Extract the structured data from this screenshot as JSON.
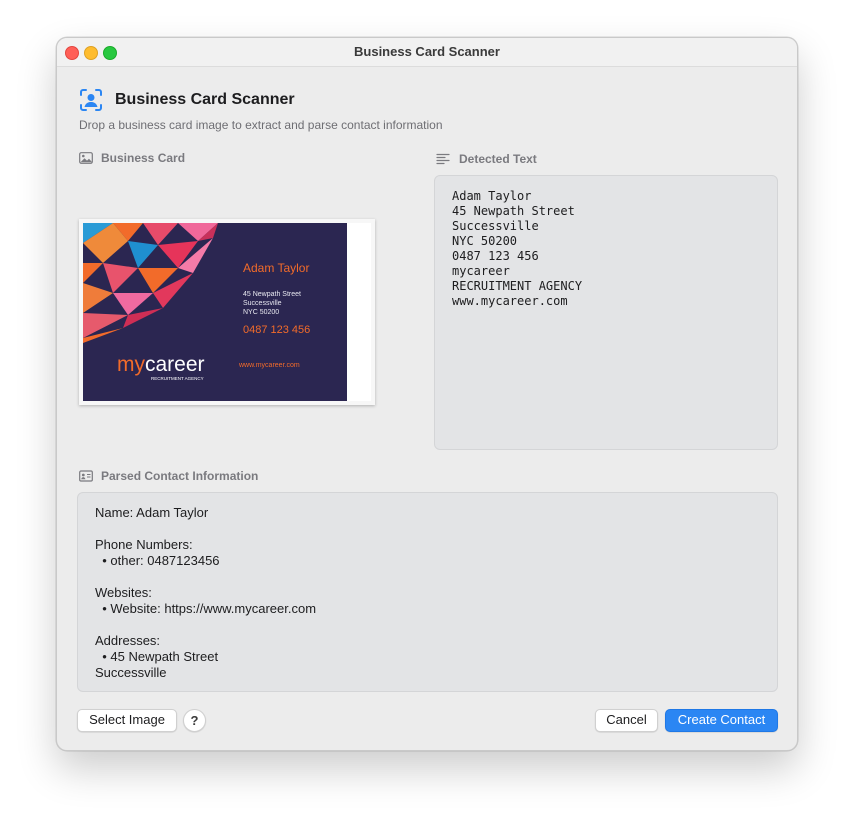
{
  "window": {
    "title": "Business Card Scanner"
  },
  "header": {
    "icon": "person-viewfinder-icon",
    "title": "Business Card Scanner",
    "subtitle": "Drop a business card image to extract and parse contact information"
  },
  "business_card_section": {
    "label": "Business Card",
    "icon": "photo-icon",
    "card": {
      "name": "Adam Taylor",
      "address_lines": [
        "45 Newpath Street",
        "Successville",
        "NYC 50200"
      ],
      "phone": "0487 123 456",
      "brand_my": "my",
      "brand_career": "career",
      "brand_tagline": "RECRUITMENT AGENCY",
      "website": "www.mycareer.com",
      "colors": {
        "background": "#2b2651",
        "accent": "#f26b2a"
      }
    }
  },
  "detected_section": {
    "label": "Detected Text",
    "icon": "text-align-left-icon",
    "lines": [
      "Adam Taylor",
      "45 Newpath Street",
      "Successville",
      "NYC 50200",
      "0487 123 456",
      "mycareer",
      "RECRUITMENT AGENCY",
      "www.mycareer.com"
    ]
  },
  "parsed_section": {
    "label": "Parsed Contact Information",
    "icon": "contact-card-icon",
    "name_line": "Name: Adam Taylor",
    "phone_heading": "Phone Numbers:",
    "phone_item": "  • other: 0487123456",
    "websites_heading": "Websites:",
    "website_item": "  • Website: https://www.mycareer.com",
    "addresses_heading": "Addresses:",
    "address_item": "  • 45 Newpath Street",
    "address_cont": "Successville"
  },
  "footer": {
    "select_image": "Select Image",
    "help": "?",
    "cancel": "Cancel",
    "create_contact": "Create Contact"
  },
  "colors": {
    "accent": "#2b86f3",
    "window_bg": "#ececec",
    "box_bg": "#e3e4e6"
  }
}
